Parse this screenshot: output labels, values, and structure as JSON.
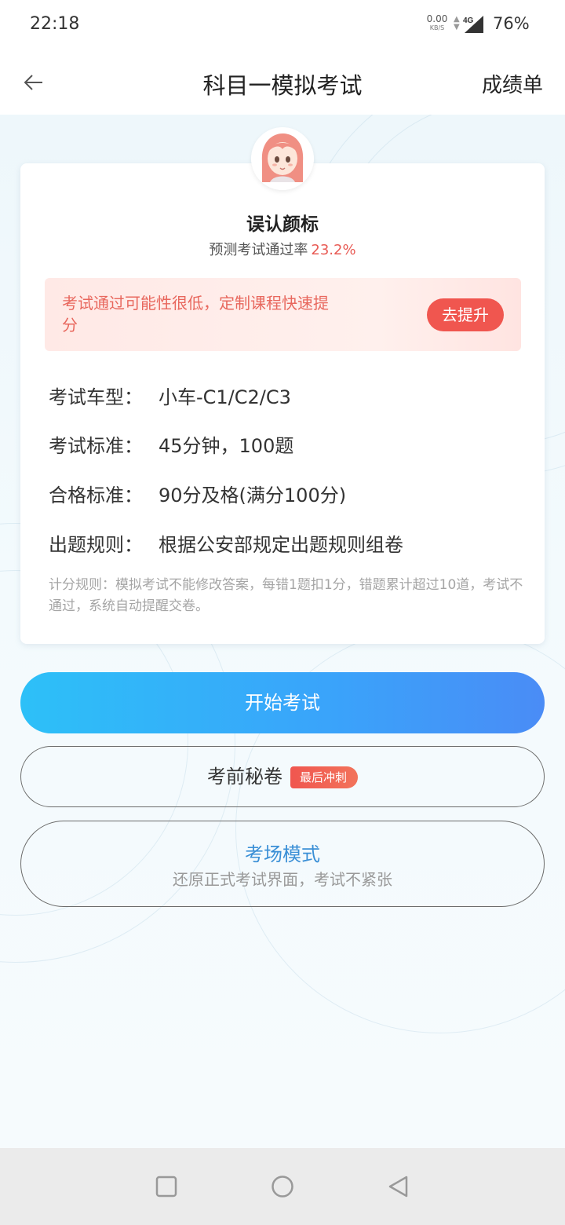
{
  "status_bar": {
    "time": "22:18",
    "net_speed": "0.00",
    "net_unit": "KB/S",
    "network": "4G",
    "battery": "76%"
  },
  "header": {
    "title": "科目一模拟考试",
    "right_action": "成绩单",
    "back_icon": "back-arrow-icon"
  },
  "card": {
    "user_name": "误认颜标",
    "pass_rate_label": "预测考试通过率",
    "pass_rate_value": "23.2%",
    "promo": {
      "text": "考试通过可能性很低，定制课程快速提分",
      "button": "去提升"
    },
    "info": [
      {
        "label": "考试车型：",
        "value": "小车-C1/C2/C3"
      },
      {
        "label": "考试标准：",
        "value": "45分钟，100题"
      },
      {
        "label": "合格标准：",
        "value": "90分及格(满分100分)"
      },
      {
        "label": "出题规则：",
        "value": "根据公安部规定出题规则组卷"
      }
    ],
    "rule_note": "计分规则：模拟考试不能修改答案，每错1题扣1分，错题累计超过10道，考试不通过，系统自动提醒交卷。"
  },
  "actions": {
    "start_exam": "开始考试",
    "secret_paper": "考前秘卷",
    "secret_badge": "最后冲刺",
    "exam_mode_title": "考场模式",
    "exam_mode_sub": "还原正式考试界面，考试不紧张"
  },
  "colors": {
    "accent_red": "#f0564f",
    "accent_blue": "#3aa3fa",
    "link_blue": "#3a8fd6"
  }
}
